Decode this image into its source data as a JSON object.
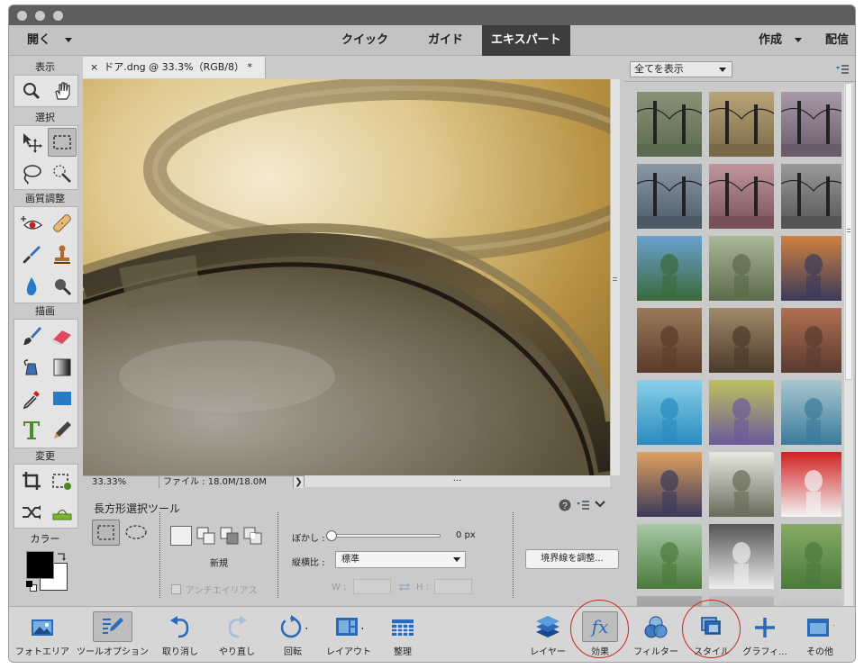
{
  "menubar": {
    "open_label": "開く",
    "modes": [
      "クイック",
      "ガイド",
      "エキスパート"
    ],
    "active_mode": "エキスパート",
    "create_label": "作成",
    "share_label": "配信"
  },
  "toolbox": {
    "sections": {
      "view": "表示",
      "select": "選択",
      "enhance": "画質調整",
      "draw": "描画",
      "modify": "変更",
      "color": "カラー"
    },
    "tools": {
      "zoom": "zoom-icon",
      "hand": "hand-icon",
      "move": "move-icon",
      "rect_marquee": "rectangular-marquee-icon",
      "lasso": "lasso-icon",
      "quick_select": "quick-selection-icon",
      "red_eye": "red-eye-icon",
      "healing": "healing-brush-icon",
      "smart_brush": "smart-brush-icon",
      "stamp": "clone-stamp-icon",
      "blur": "blur-drop-icon",
      "sponge": "sponge-icon",
      "brush": "brush-icon",
      "eraser": "eraser-icon",
      "paint_bucket": "paint-bucket-icon",
      "gradient": "gradient-icon",
      "eyedropper": "eyedropper-icon",
      "shape": "rectangle-shape-icon",
      "type": "type-icon",
      "pencil": "pencil-icon",
      "crop": "crop-icon",
      "recompose": "recompose-icon",
      "content_move": "content-aware-move-icon",
      "straighten": "straighten-icon"
    },
    "colors": {
      "foreground": "#000000",
      "background": "#ffffff"
    }
  },
  "document": {
    "tab_close": "×",
    "tab_title": "ドア.dng @ 33.3%（RGB/8） *"
  },
  "statusbar": {
    "zoom": "33.33%",
    "file_info": "ファイル : 18.0M/18.0M",
    "arrow": "❯",
    "grip": "···"
  },
  "tool_options": {
    "title": "長方形選択ツール",
    "mode_new_label": "新規",
    "antialias_label": "アンチエイリアス",
    "feather_label": "ぼかし :",
    "feather_value": "0 px",
    "feather_fraction": 0,
    "aspect_label": "縦横比 :",
    "aspect_value": "標準",
    "w_label": "W :",
    "h_label": "H :",
    "refine_button": "境界線を調整..."
  },
  "right_panel": {
    "filter_dropdown": "全てを表示",
    "rows": 8,
    "columns": 3
  },
  "bottombar": {
    "left": [
      {
        "label": "フォトエリア",
        "icon": "photo-bin-icon"
      },
      {
        "label": "ツールオプション",
        "icon": "tool-options-icon"
      },
      {
        "label": "取り消し",
        "icon": "undo-icon"
      },
      {
        "label": "やり直し",
        "icon": "redo-icon"
      },
      {
        "label": "回転",
        "icon": "rotate-icon"
      },
      {
        "label": "レイアウト",
        "icon": "layout-icon"
      },
      {
        "label": "整理",
        "icon": "organizer-icon"
      }
    ],
    "right": [
      {
        "label": "レイヤー",
        "icon": "layers-icon"
      },
      {
        "label": "効果",
        "icon": "fx-icon"
      },
      {
        "label": "フィルター",
        "icon": "filter-icon"
      },
      {
        "label": "スタイル",
        "icon": "styles-icon"
      },
      {
        "label": "グラフィ...",
        "icon": "graphics-plus-icon"
      },
      {
        "label": "その他",
        "icon": "more-icon"
      }
    ]
  },
  "annotation_color": "#c8281c"
}
